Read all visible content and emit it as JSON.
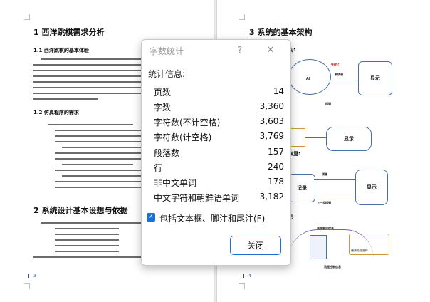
{
  "left_page": {
    "heading1": "1  西洋跳棋需求分析",
    "heading1_1": "1.1  西洋跳棋的基本体验",
    "heading1_2": "1.2  仿真程序的需求",
    "heading2": "2  系统设计基本设想与依据",
    "page_number": "3"
  },
  "right_page": {
    "heading3": "3  系统的基本架构",
    "frag_arch": "构:",
    "frag_recover": "恢复:",
    "frag_control": "制",
    "labels": {
      "display": "显示",
      "record": "记录",
      "ai": "AI",
      "new_board": "新棋谱",
      "failure": "失败了",
      "board": "棋谱",
      "prev_board": "上一步棋谱",
      "event_msg": "事件响应信息",
      "flow_msg": "流程控制信息",
      "scene_msg": "便景处理器件"
    },
    "page_number": "4"
  },
  "dialog": {
    "title": "字数统计",
    "help": "?",
    "close_glyph": "✕",
    "stats_heading": "统计信息:",
    "stats": [
      {
        "label": "页数",
        "value": "14"
      },
      {
        "label": "字数",
        "value": "3,360"
      },
      {
        "label": "字符数(不计空格)",
        "value": "3,603"
      },
      {
        "label": "字符数(计空格)",
        "value": "3,769"
      },
      {
        "label": "段落数",
        "value": "157"
      },
      {
        "label": "行",
        "value": "240"
      },
      {
        "label": "非中文单词",
        "value": "178"
      },
      {
        "label": "中文字符和朝鲜语单词",
        "value": "3,182"
      }
    ],
    "checkbox_label": "包括文本框、脚注和尾注(F)",
    "checkbox_checked": true,
    "close_button": "关闭"
  },
  "colors": {
    "accent": "#1f6fcf",
    "page_number": "#2b579a"
  }
}
